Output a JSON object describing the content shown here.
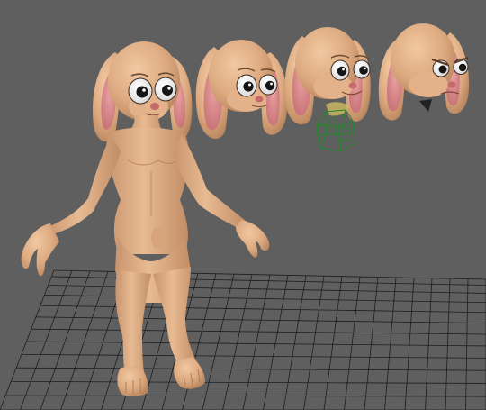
{
  "viewport": {
    "background": "#5f5f5f",
    "grid_color": "#1e1e1e",
    "selection_color": "#1e8a2a"
  },
  "scene": {
    "character": {
      "skin_color": "#ddaa80",
      "inner_ear_color": "#d8868a",
      "nose_color": "#c66a6a"
    },
    "heads": [
      {
        "expression": "neutral"
      },
      {
        "expression": "wide-eyed"
      },
      {
        "expression": "smile"
      },
      {
        "expression": "angry"
      }
    ],
    "selected_object": "joint-controller"
  }
}
